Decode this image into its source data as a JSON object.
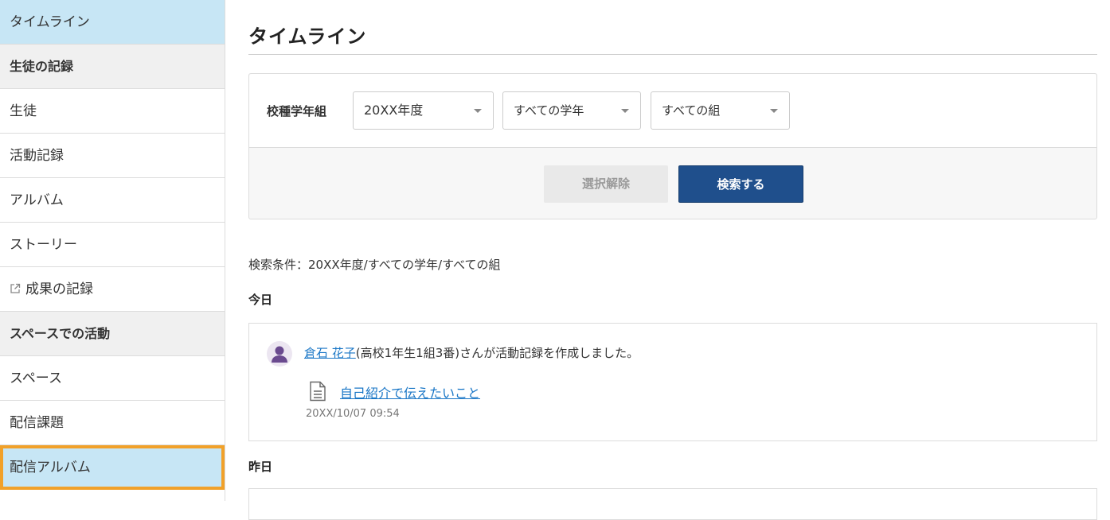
{
  "sidebar": {
    "items": [
      {
        "label": "タイムライン",
        "kind": "active"
      },
      {
        "label": "生徒の記録",
        "kind": "section"
      },
      {
        "label": "生徒",
        "kind": "item"
      },
      {
        "label": "活動記録",
        "kind": "item"
      },
      {
        "label": "アルバム",
        "kind": "item"
      },
      {
        "label": "ストーリー",
        "kind": "item"
      },
      {
        "label": "成果の記録",
        "kind": "external",
        "icon": "external-link-icon"
      },
      {
        "label": "スペースでの活動",
        "kind": "section"
      },
      {
        "label": "スペース",
        "kind": "item"
      },
      {
        "label": "配信課題",
        "kind": "item"
      },
      {
        "label": "配信アルバム",
        "kind": "highlight"
      }
    ]
  },
  "main": {
    "title": "タイムライン",
    "filter": {
      "label": "校種学年組",
      "year": "20XX年度",
      "grade": "すべての学年",
      "class": "すべての組",
      "clear_label": "選択解除",
      "search_label": "検索する"
    },
    "conditions": "検索条件：20XX年度/すべての学年/すべての組",
    "today_label": "今日",
    "yesterday_label": "昨日",
    "today_entry": {
      "user_name": "倉石 花子",
      "user_detail": "(高校1年生1組3番)さんが活動記録を作成しました。",
      "document_title": "自己紹介で伝えたいこと",
      "timestamp": "20XX/10/07 09:54"
    }
  },
  "colors": {
    "active_bg": "#c7e6f5",
    "highlight_border": "#f1a12a",
    "primary_button": "#1f4f8c",
    "link": "#1976c6"
  }
}
